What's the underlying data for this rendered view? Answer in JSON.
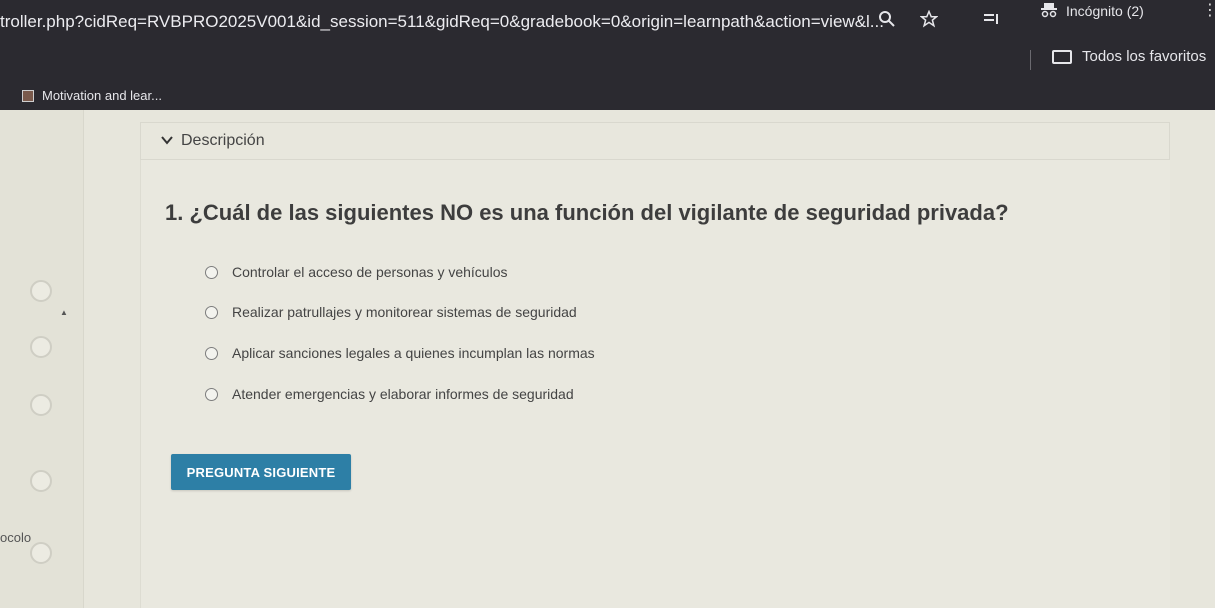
{
  "browser": {
    "url": "troller.php?cidReq=RVBPRO2025V001&id_session=511&gidReq=0&gradebook=0&origin=learnpath&action=view&l...",
    "incognito_label": "Incógnito (2)",
    "bookmarks_all_label": "Todos los favoritos",
    "tab_title": "Motivation and lear..."
  },
  "sidebar": {
    "label": "ocolo"
  },
  "section": {
    "header": "Descripción"
  },
  "question": {
    "title": "1. ¿Cuál de las siguientes NO es una función del vigilante de seguridad privada?",
    "options": [
      "Controlar el acceso de personas y vehículos",
      "Realizar patrullajes y monitorear sistemas de seguridad",
      "Aplicar sanciones legales a quienes incumplan las normas",
      "Atender emergencias y elaborar informes de seguridad"
    ],
    "next_label": "PREGUNTA SIGUIENTE"
  },
  "colors": {
    "browser_chrome": "#2b2a30",
    "page_bg": "#e7e6dc",
    "button_blue": "#2d7fa6"
  },
  "icons": [
    "search-icon",
    "star-icon",
    "reading-list-icon",
    "incognito-icon",
    "menu-icon",
    "folder-icon",
    "chevron-down-icon",
    "radio-icon"
  ]
}
